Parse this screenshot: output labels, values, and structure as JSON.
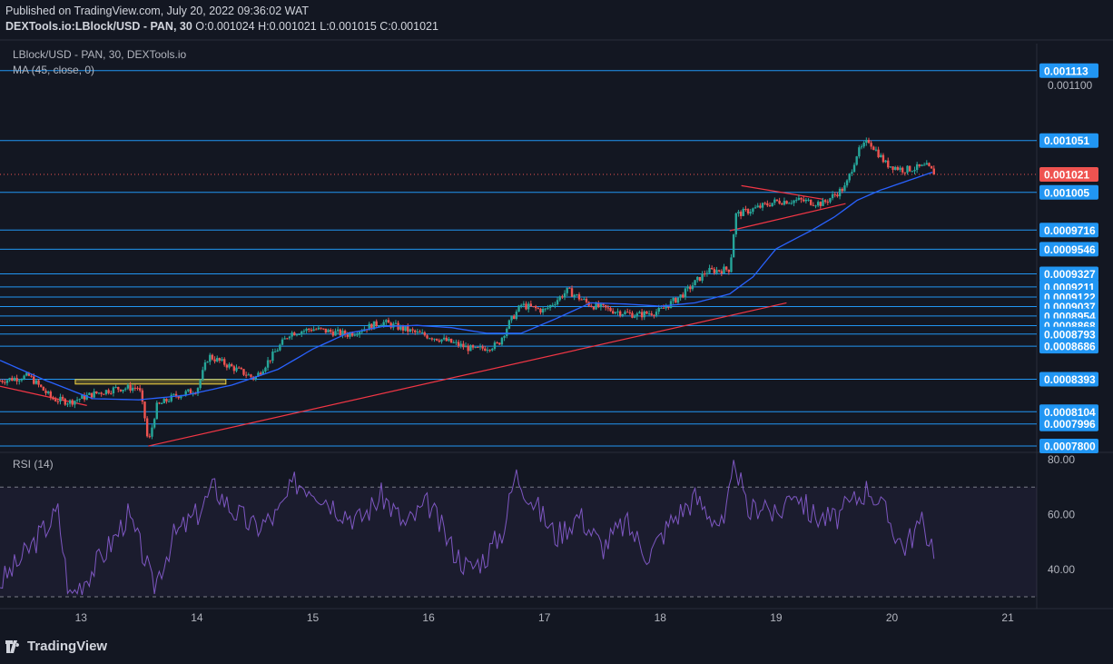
{
  "header": {
    "published": "Published on TradingView.com, July 20, 2022 09:36:02 WAT",
    "symbol": "DEXTools.io:LBlock/USD - PAN, 30",
    "ohlc": {
      "o": "O:0.001024",
      "h": "H:0.001021",
      "l": "L:0.001015",
      "c": "C:0.001021"
    }
  },
  "legend": {
    "series": "LBlock/USD - PAN, 30, DEXTools.io",
    "ma": "MA (45, close, 0)",
    "rsi": "RSI (14)"
  },
  "brand": "TradingView",
  "colors": {
    "background": "#131722",
    "up": "#26a69a",
    "down": "#ef5350",
    "ma": "#2962ff",
    "level": "#2196f3",
    "trend": "#f23645",
    "rsi": "#7e57c2",
    "zone": "#f5d742"
  },
  "chart_data": [
    {
      "type": "candlestick",
      "title": "LBlock/USD - PAN, 30, DEXTools.io",
      "x_ticks": [
        "13",
        "14",
        "15",
        "16",
        "17",
        "18",
        "19",
        "20",
        "21"
      ],
      "x_range": [
        12.3,
        21.25
      ],
      "ylim": [
        0.000776,
        0.001137
      ],
      "y_ticks": [
        "0.001100"
      ],
      "horizontal_levels": [
        "0.001113",
        "0.001051",
        "0.001005",
        "0.0009716",
        "0.0009546",
        "0.0009327",
        "0.0009211",
        "0.0009122",
        "0.0009037",
        "0.0008954",
        "0.0008868",
        "0.0008793",
        "0.0008686",
        "0.0008393",
        "0.0008104",
        "0.0007996",
        "0.0007800"
      ],
      "last_price": "0.001021",
      "series": [
        {
          "name": "price (approx. close path)",
          "x": [
            12.3,
            12.55,
            12.75,
            12.9,
            13.1,
            13.3,
            13.5,
            13.55,
            13.58,
            13.65,
            13.8,
            14.0,
            14.1,
            14.3,
            14.5,
            14.65,
            14.8,
            15.0,
            15.3,
            15.6,
            15.9,
            16.1,
            16.4,
            16.6,
            16.7,
            16.8,
            17.0,
            17.2,
            17.4,
            17.6,
            17.8,
            18.0,
            18.2,
            18.4,
            18.6,
            18.65,
            18.8,
            19.0,
            19.2,
            19.4,
            19.6,
            19.7,
            19.8,
            19.95,
            20.1,
            20.3,
            20.38
          ],
          "values": [
            0.000838,
            0.000842,
            0.000822,
            0.000819,
            0.000826,
            0.000831,
            0.000832,
            0.000805,
            0.000781,
            0.000815,
            0.000824,
            0.00083,
            0.00086,
            0.00085,
            0.00084,
            0.00086,
            0.00088,
            0.000884,
            0.000879,
            0.00089,
            0.00088,
            0.000875,
            0.000865,
            0.00087,
            0.00089,
            0.000905,
            0.0009,
            0.000918,
            0.000905,
            0.0009,
            0.000896,
            0.0009,
            0.000915,
            0.000935,
            0.000937,
            0.000985,
            0.00099,
            0.000997,
            0.000998,
            0.000995,
            0.00101,
            0.00104,
            0.001051,
            0.00103,
            0.001025,
            0.001028,
            0.001021
          ]
        },
        {
          "name": "MA (45, close, 0)",
          "x": [
            12.3,
            12.7,
            13.1,
            13.5,
            13.9,
            14.3,
            14.7,
            15.0,
            15.3,
            15.6,
            15.9,
            16.2,
            16.5,
            16.8,
            17.1,
            17.4,
            17.7,
            18.0,
            18.3,
            18.6,
            18.8,
            19.0,
            19.3,
            19.5,
            19.7,
            19.9,
            20.1,
            20.38
          ],
          "values": [
            0.000856,
            0.000838,
            0.000822,
            0.000821,
            0.000825,
            0.000834,
            0.000848,
            0.000866,
            0.00088,
            0.000886,
            0.000887,
            0.000885,
            0.00088,
            0.00088,
            0.000893,
            0.000907,
            0.000906,
            0.000904,
            0.000907,
            0.000915,
            0.00093,
            0.000955,
            0.000971,
            0.000983,
            0.000998,
            0.001007,
            0.001014,
            0.001024
          ]
        }
      ],
      "trendlines": [
        {
          "from": [
            13.58,
            0.00078
          ],
          "to": [
            19.09,
            0.000907
          ]
        },
        {
          "from": [
            12.3,
            0.000833
          ],
          "to": [
            13.05,
            0.000816
          ]
        },
        {
          "from": [
            18.6,
            0.000971
          ],
          "to": [
            19.6,
            0.000995
          ]
        },
        {
          "from": [
            18.7,
            0.001011
          ],
          "to": [
            19.4,
            0.000999
          ]
        }
      ],
      "zones": [
        {
          "x": [
            12.95,
            14.25
          ],
          "y": [
            0.000835,
            0.000839
          ]
        }
      ]
    },
    {
      "type": "line",
      "title": "RSI (14)",
      "ylim": [
        27,
        82
      ],
      "y_ticks": [
        "80.00",
        "60.00",
        "40.00"
      ],
      "bands": [
        30,
        70
      ],
      "series": [
        {
          "name": "RSI (14)",
          "x": [
            12.3,
            12.45,
            12.6,
            12.8,
            12.9,
            13.1,
            13.3,
            13.4,
            13.55,
            13.62,
            13.8,
            14.0,
            14.15,
            14.3,
            14.5,
            14.7,
            14.85,
            15.0,
            15.2,
            15.4,
            15.6,
            15.8,
            16.0,
            16.2,
            16.35,
            16.5,
            16.65,
            16.75,
            16.9,
            17.1,
            17.3,
            17.5,
            17.7,
            17.9,
            18.1,
            18.3,
            18.55,
            18.65,
            18.75,
            18.9,
            19.0,
            19.15,
            19.3,
            19.5,
            19.7,
            19.8,
            19.95,
            20.1,
            20.25,
            20.38
          ],
          "values": [
            35,
            42,
            50,
            61,
            30,
            40,
            52,
            60,
            44,
            33,
            52,
            60,
            70,
            62,
            55,
            60,
            72,
            70,
            63,
            58,
            67,
            56,
            64,
            48,
            40,
            45,
            55,
            75,
            65,
            52,
            60,
            48,
            57,
            45,
            58,
            66,
            55,
            80,
            60,
            65,
            58,
            70,
            60,
            58,
            66,
            70,
            60,
            48,
            57,
            47
          ]
        }
      ]
    }
  ]
}
